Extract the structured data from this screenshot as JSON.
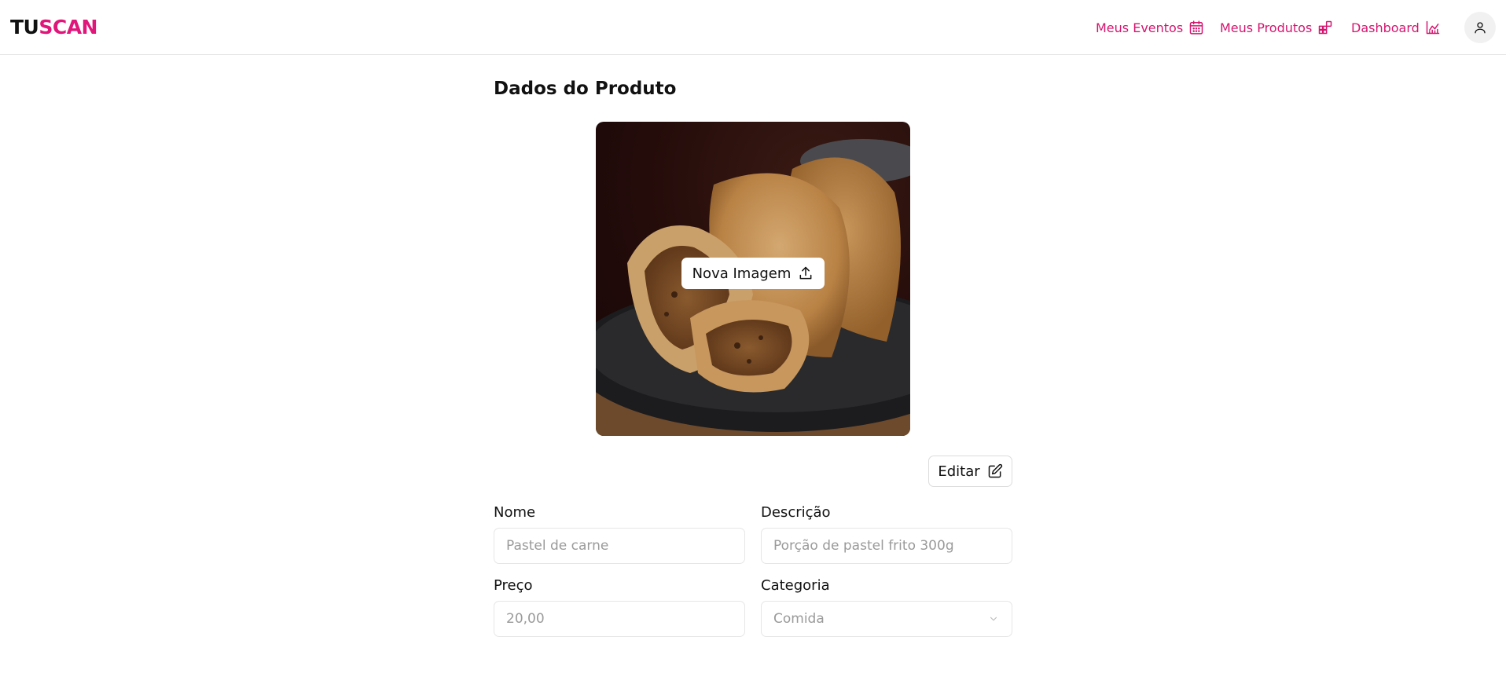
{
  "header": {
    "logo_part1": "TU",
    "logo_part2": "SCAN",
    "nav": [
      {
        "label": "Meus Eventos",
        "icon": "calendar-icon"
      },
      {
        "label": "Meus Produtos",
        "icon": "grid-plus-icon"
      },
      {
        "label": "Dashboard",
        "icon": "chart-icon"
      }
    ],
    "avatar_icon": "user-icon"
  },
  "main": {
    "title": "Dados do Produto",
    "image": {
      "upload_label": "Nova Imagem",
      "upload_icon": "upload-icon"
    },
    "edit_label": "Editar",
    "edit_icon": "edit-icon",
    "form": {
      "name_label": "Nome",
      "name_value": "Pastel de carne",
      "description_label": "Descrição",
      "description_value": "Porção de pastel frito 300g",
      "price_label": "Preço",
      "price_value": "20,00",
      "category_label": "Categoria",
      "category_value": "Comida"
    }
  },
  "colors": {
    "brand": "#e0167a",
    "nav_text": "#d4156f"
  }
}
